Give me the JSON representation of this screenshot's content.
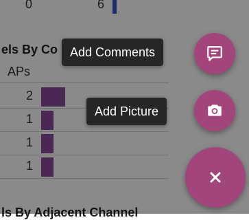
{
  "top_row": {
    "left_value": "0",
    "right_value": "6"
  },
  "section1": {
    "title": "els By Co",
    "column_header": "APs",
    "rows": [
      {
        "count": "2",
        "fraction": 0.55
      },
      {
        "count": "1",
        "fraction": 0.28
      },
      {
        "count": "1",
        "fraction": 0.28
      },
      {
        "count": "1",
        "fraction": 0.28
      }
    ]
  },
  "section2": {
    "title": "ls By Adjacent Channel"
  },
  "speed_dial": {
    "add_comments_label": "Add Comments",
    "add_picture_label": "Add Picture",
    "comments_icon": "comment-icon",
    "picture_icon": "camera-icon",
    "close_icon": "close-icon"
  },
  "colors": {
    "fab": "#a1457b",
    "bar": "#8a4a99",
    "top_bar": "#3b54c8",
    "tooltip": "#262626"
  }
}
